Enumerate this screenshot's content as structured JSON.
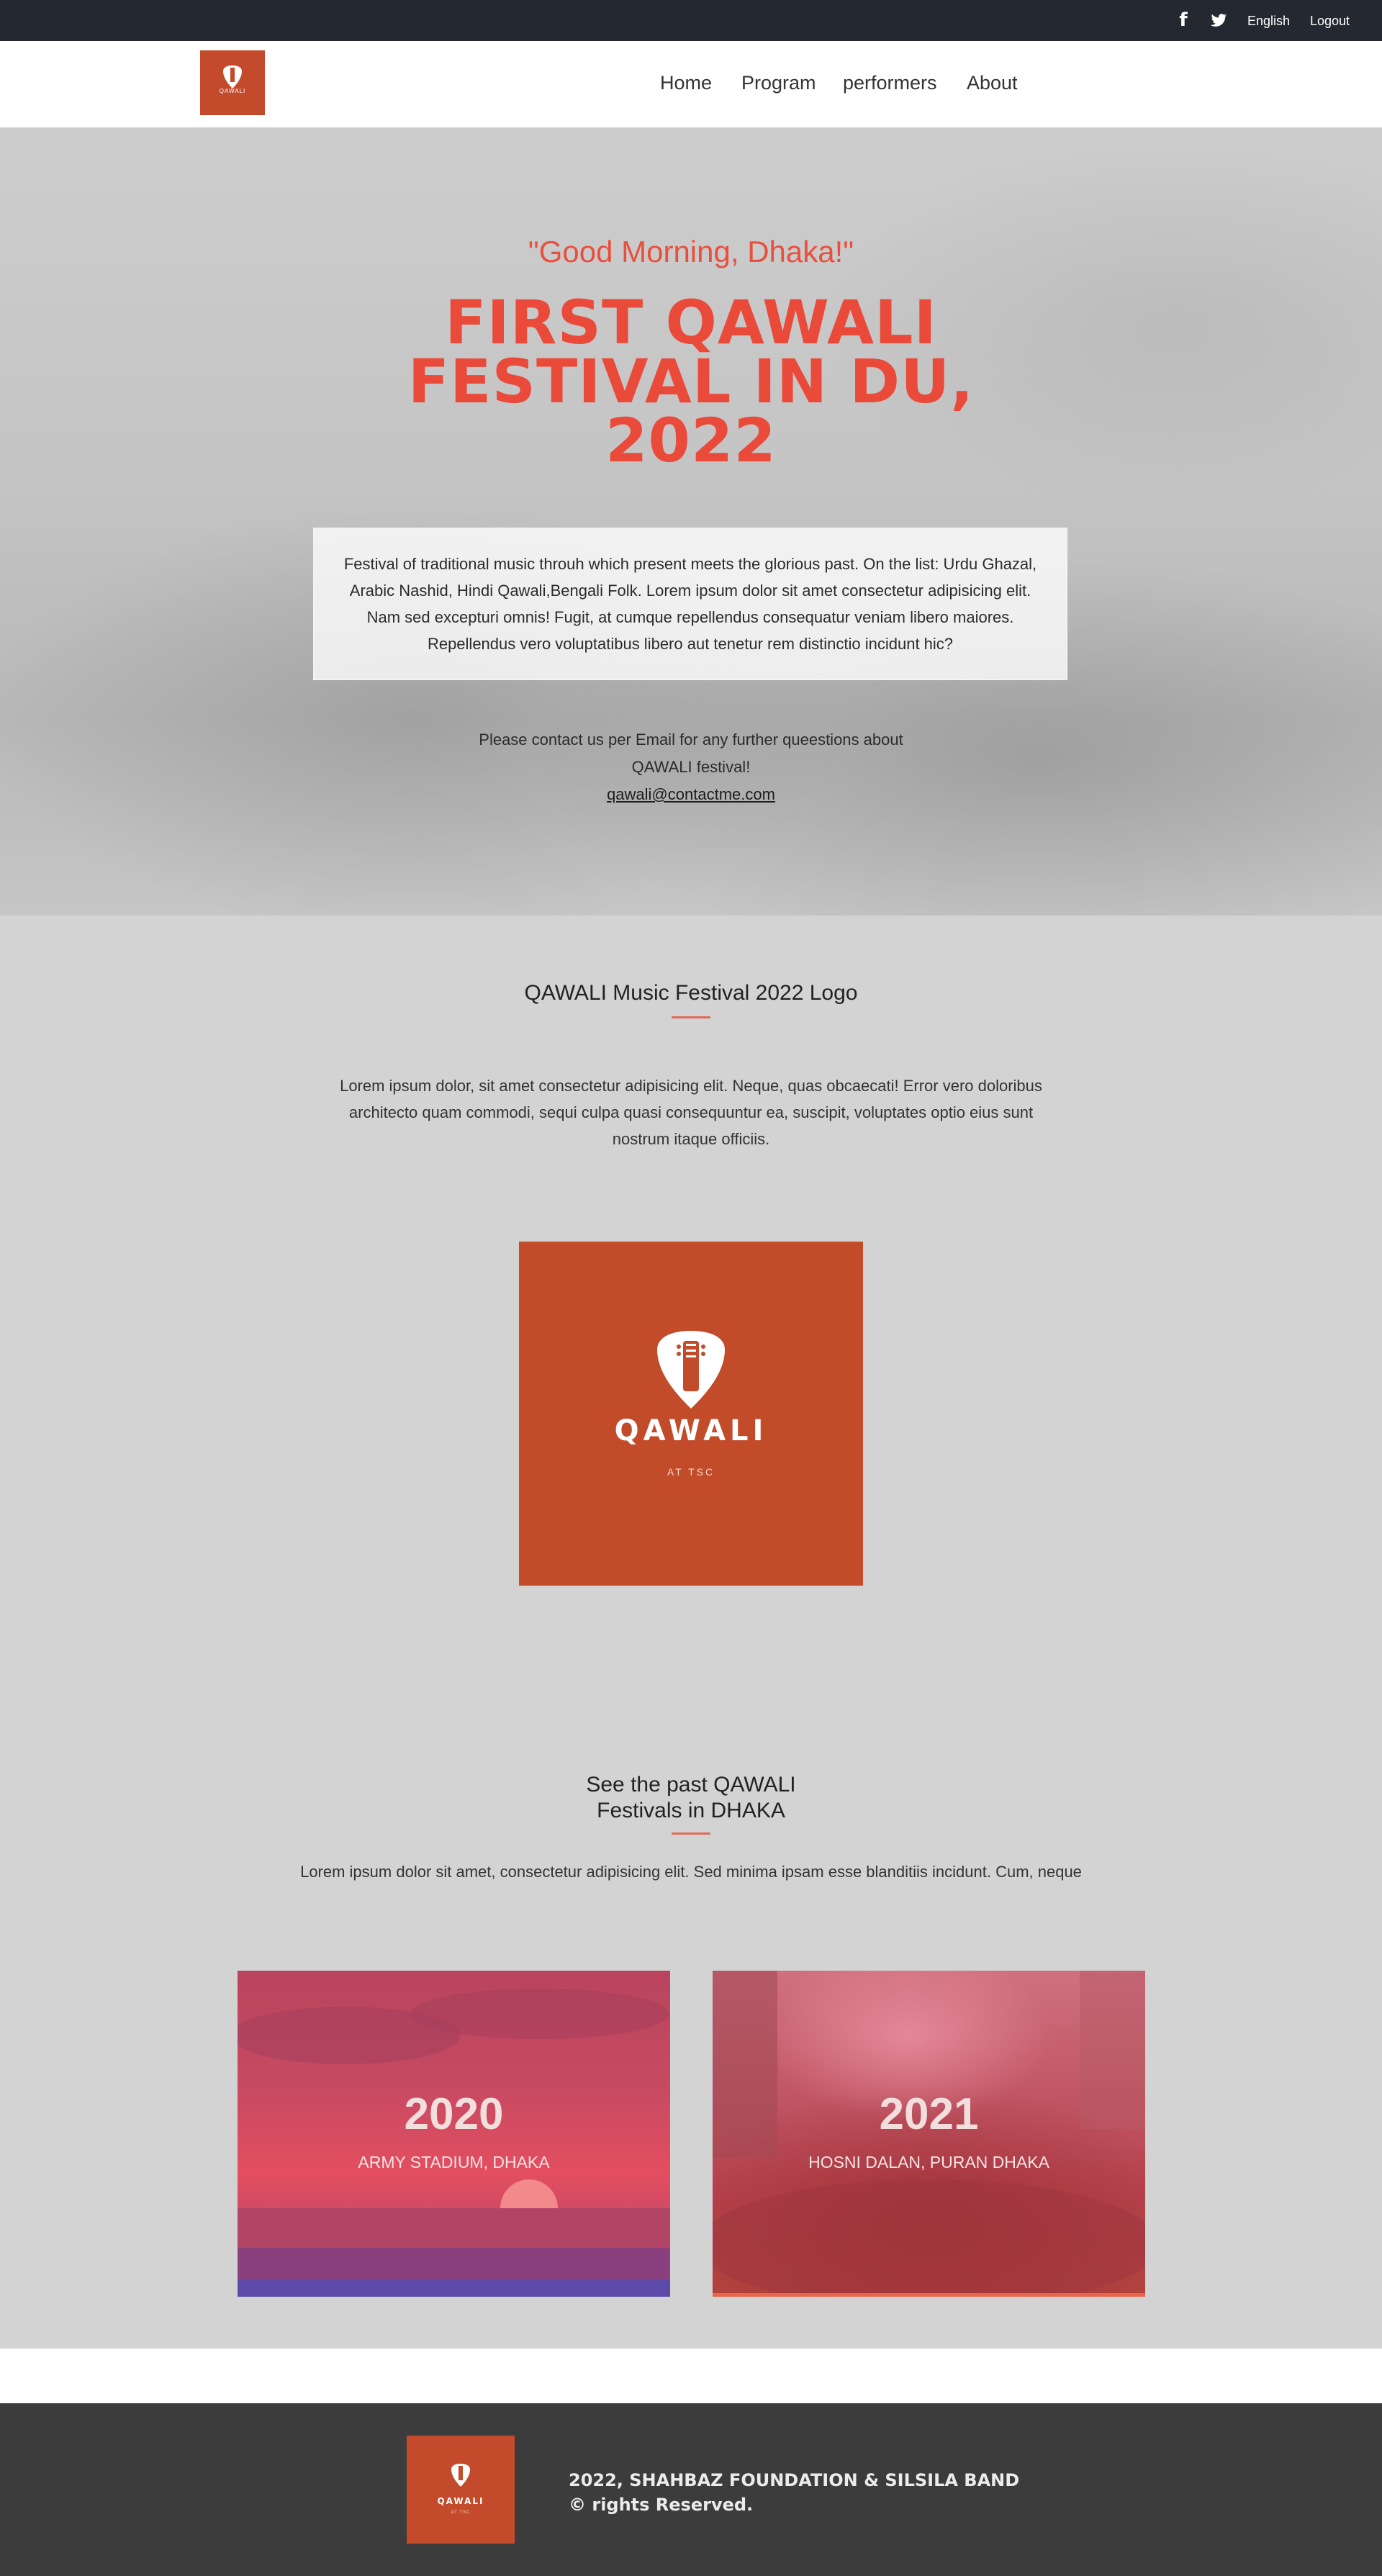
{
  "topbar": {
    "facebook_icon": "facebook-icon",
    "twitter_icon": "twitter-icon",
    "language": "English",
    "logout": "Logout"
  },
  "nav": {
    "brand_text": "QAWALI",
    "links": [
      "Home",
      "Program",
      "performers",
      "About"
    ]
  },
  "hero": {
    "greeting": "\"Good Morning, Dhaka!\"",
    "title": "FIRST QAWALI FESTIVAL IN DU, 2022",
    "description": "Festival of traditional music throuh which present meets the glorious past. On the list: Urdu Ghazal, Arabic Nashid, Hindi Qawali,Bengali Folk. Lorem ipsum dolor sit amet consectetur adipisicing elit. Nam sed excepturi omnis! Fugit, at cumque repellendus consequatur veniam libero maiores. Repellendus vero voluptatibus libero aut tenetur rem distinctio incidunt hic?",
    "contact_line": "Please contact us per Email for any further queestions about QAWALI festival!",
    "email": "qawali@contactme.com"
  },
  "logo_section": {
    "title": "QAWALI Music Festival 2022 Logo",
    "text": "Lorem ipsum dolor, sit amet consectetur adipisicing elit. Neque, quas obcaecati! Error vero doloribus architecto quam commodi, sequi culpa quasi consequuntur ea, suscipit, voluptates optio eius sunt nostrum itaque officiis.",
    "logo_name": "QAWALI",
    "logo_sub": "AT TSC"
  },
  "past_section": {
    "title_line1": "See the past QAWALI",
    "title_line2": "Festivals in DHAKA",
    "text": "Lorem ipsum dolor sit amet, consectetur adipisicing elit. Sed minima ipsam esse blanditiis incidunt. Cum, neque",
    "cards": [
      {
        "year": "2020",
        "location": "ARMY STADIUM, DHAKA"
      },
      {
        "year": "2021",
        "location": "HOSNI DALAN, PURAN DHAKA"
      }
    ]
  },
  "footer": {
    "logo_name": "QAWALI",
    "logo_sub": "AT TSC",
    "line1": "2022, SHAHBAZ FOUNDATION & SILSILA BAND",
    "line2": "© rights Reserved."
  },
  "colors": {
    "accent": "#ea4a3a",
    "brand": "#c44a2c",
    "topbar": "#242831",
    "footer": "#3c3c3c"
  }
}
